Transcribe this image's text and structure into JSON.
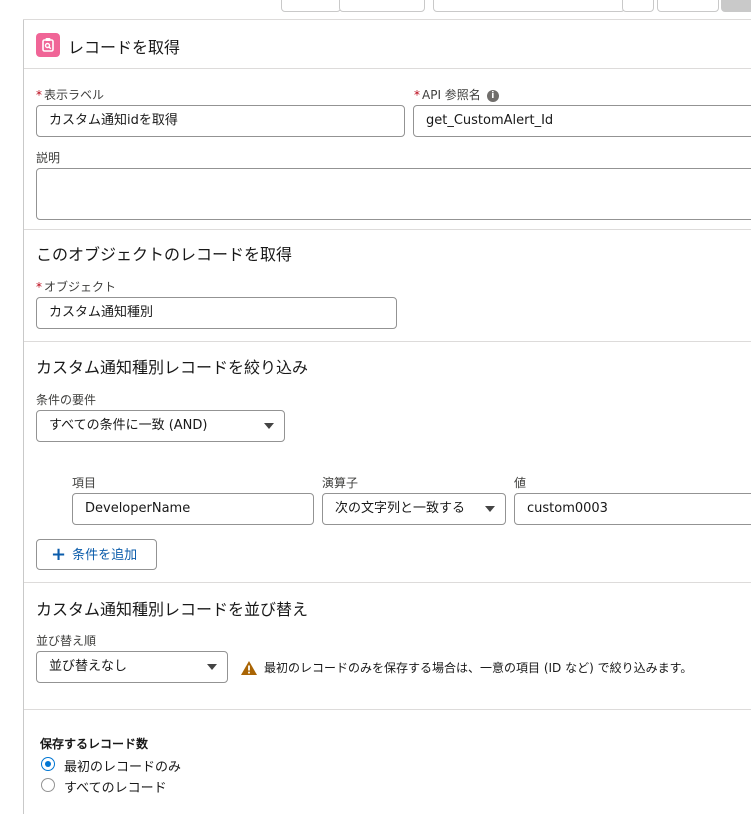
{
  "header": {
    "title": "レコードを取得",
    "icon": "get-records-icon",
    "icon_color": "#f06597"
  },
  "general": {
    "label_field": {
      "label": "表示ラベル",
      "required_mark": "*",
      "value": "カスタム通知idを取得"
    },
    "api_field": {
      "label": "API 参照名",
      "required_mark": "*",
      "value": "get_CustomAlert_Id",
      "info_icon": "i"
    },
    "description": {
      "label": "説明",
      "value": ""
    }
  },
  "object_section": {
    "title": "このオブジェクトのレコードを取得",
    "object_field": {
      "label": "オブジェクト",
      "required_mark": "*",
      "value": "カスタム通知種別"
    }
  },
  "filter_section": {
    "title": "カスタム通知種別レコードを絞り込み",
    "condition_label": "条件の要件",
    "condition_value": "すべての条件に一致 (AND)",
    "columns": {
      "field": "項目",
      "operator": "演算子",
      "value": "値"
    },
    "row": {
      "field": "DeveloperName",
      "operator": "次の文字列と一致する",
      "value": "custom0003"
    },
    "add_button": {
      "plus": "+",
      "label": "条件を追加"
    }
  },
  "sort_section": {
    "title": "カスタム通知種別レコードを並び替え",
    "order_label": "並び替え順",
    "order_value": "並び替えなし",
    "warning": "最初のレコードのみを保存する場合は、一意の項目 (ID など) で絞り込みます。",
    "warning_color": "#a96404"
  },
  "store_section": {
    "title": "保存するレコード数",
    "options": [
      {
        "label": "最初のレコードのみ",
        "selected": true
      },
      {
        "label": "すべてのレコード",
        "selected": false
      }
    ]
  },
  "accent_color": "#0176d3"
}
